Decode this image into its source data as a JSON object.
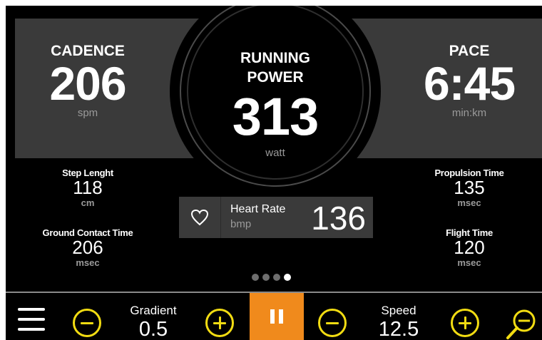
{
  "cadence": {
    "title": "CADENCE",
    "value": "206",
    "unit": "spm"
  },
  "running_power": {
    "title_line1": "RUNNING",
    "title_line2": "POWER",
    "value": "313",
    "unit": "watt"
  },
  "pace": {
    "title": "PACE",
    "value": "6:45",
    "unit": "min:km"
  },
  "step_length": {
    "title": "Step Lenght",
    "value": "118",
    "unit": "cm"
  },
  "ground_contact": {
    "title": "Ground Contact Time",
    "value": "206",
    "unit": "msec"
  },
  "propulsion": {
    "title": "Propulsion Time",
    "value": "135",
    "unit": "msec"
  },
  "flight": {
    "title": "Flight Time",
    "value": "120",
    "unit": "msec"
  },
  "heart_rate": {
    "label": "Heart Rate",
    "unit": "bmp",
    "value": "136",
    "icon": "heart-icon"
  },
  "pager": {
    "count": 4,
    "active_index": 3
  },
  "controls": {
    "gradient": {
      "label": "Gradient",
      "value": "0.5"
    },
    "speed": {
      "label": "Speed",
      "value": "12.5"
    },
    "pause_icon": "pause-icon",
    "menu_icon": "hamburger-menu-icon",
    "zoom_icon": "zoom-out-icon"
  },
  "colors": {
    "accent_yellow": "#f2dc12",
    "pause_orange": "#f08a1c",
    "panel_grey": "#3a3a3a",
    "unit_grey": "#9a9a9a"
  }
}
